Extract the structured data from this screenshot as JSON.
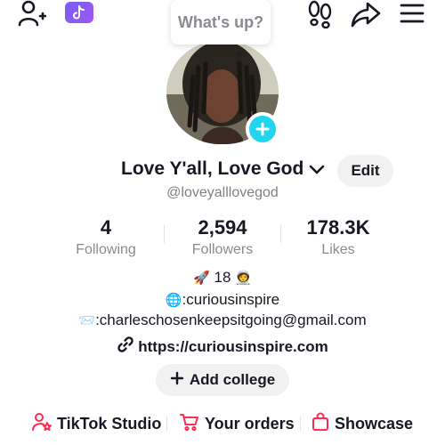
{
  "status_bubble": {
    "text": "What's up?"
  },
  "header": {
    "icons": [
      "add-friend-icon",
      "tiktok-logo-icon",
      "footprint-icon",
      "share-icon",
      "hamburger-menu-icon"
    ]
  },
  "profile": {
    "display_name": "Love Y'all, Love God",
    "edit_label": "Edit",
    "handle": "@loveyalllovegod"
  },
  "stats": [
    {
      "value": "4",
      "label": "Following"
    },
    {
      "value": "2,594",
      "label": "Followers"
    },
    {
      "value": "178.3K",
      "label": "Likes"
    }
  ],
  "bio": {
    "line1_emoji_left": "🚀",
    "line1_text": " 18 ",
    "line1_emoji_right": "🧑‍🚀",
    "line2_emoji": "🌐",
    "line2_text": ":curiousinspire",
    "line3_emoji": "📨",
    "line3_text": ":charleschosenkeepsitgoing@gmail.com"
  },
  "link": {
    "text": "https://curiousinspire.com"
  },
  "add_college": {
    "label": "Add college"
  },
  "bottom_links": [
    {
      "label": "TikTok Studio"
    },
    {
      "label": "Your orders"
    },
    {
      "label": "Showcase"
    }
  ],
  "colors": {
    "accent_cyan": "#20d5ec",
    "tiktok_badge": "#8a5cf3",
    "link_red": "#fe2c55",
    "text_primary": "#161823",
    "text_secondary": "#8a8b91"
  }
}
